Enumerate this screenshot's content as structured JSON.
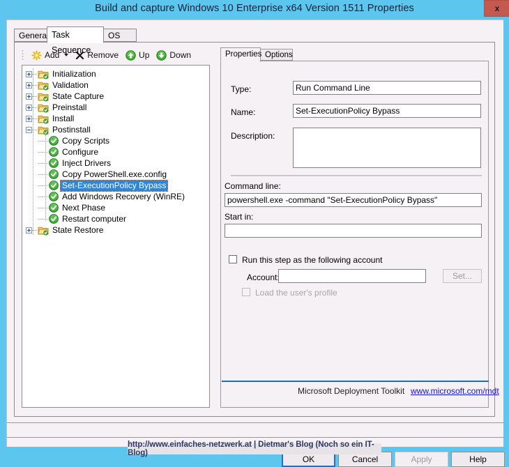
{
  "window": {
    "title": "Build and capture Windows 10 Enterprise x64 Version 1511 Properties",
    "close_label": "x",
    "titlebar_color": "#5cc6ee",
    "close_color": "#c45a4f"
  },
  "tabs": [
    {
      "label": "General",
      "active": false
    },
    {
      "label": "Task Sequence",
      "active": true
    },
    {
      "label": "OS Info",
      "active": false
    }
  ],
  "toolbar": {
    "add_label": "Add",
    "remove_label": "Remove",
    "up_label": "Up",
    "down_label": "Down"
  },
  "tree": {
    "nodes": [
      {
        "label": "Initialization",
        "depth": 0,
        "type": "folder",
        "expander": "plus",
        "selected": false
      },
      {
        "label": "Validation",
        "depth": 0,
        "type": "folder",
        "expander": "plus",
        "selected": false
      },
      {
        "label": "State Capture",
        "depth": 0,
        "type": "folder",
        "expander": "plus",
        "selected": false
      },
      {
        "label": "Preinstall",
        "depth": 0,
        "type": "folder",
        "expander": "plus",
        "selected": false
      },
      {
        "label": "Install",
        "depth": 0,
        "type": "folder",
        "expander": "plus",
        "selected": false
      },
      {
        "label": "Postinstall",
        "depth": 0,
        "type": "folder",
        "expander": "minus",
        "selected": false
      },
      {
        "label": "Copy Scripts",
        "depth": 1,
        "type": "step",
        "expander": "none",
        "selected": false
      },
      {
        "label": "Configure",
        "depth": 1,
        "type": "step",
        "expander": "none",
        "selected": false
      },
      {
        "label": "Inject Drivers",
        "depth": 1,
        "type": "step",
        "expander": "none",
        "selected": false
      },
      {
        "label": "Copy PowerShell.exe.config",
        "depth": 1,
        "type": "step",
        "expander": "none",
        "selected": false
      },
      {
        "label": "Set-ExecutionPolicy Bypass",
        "depth": 1,
        "type": "step",
        "expander": "none",
        "selected": true
      },
      {
        "label": "Add Windows Recovery (WinRE)",
        "depth": 1,
        "type": "step",
        "expander": "none",
        "selected": false
      },
      {
        "label": "Next Phase",
        "depth": 1,
        "type": "step",
        "expander": "none",
        "selected": false
      },
      {
        "label": "Restart computer",
        "depth": 1,
        "type": "step",
        "expander": "none",
        "selected": false
      },
      {
        "label": "State Restore",
        "depth": 0,
        "type": "folder",
        "expander": "plus",
        "selected": false
      }
    ]
  },
  "details": {
    "tabs": [
      {
        "label": "Properties",
        "active": true
      },
      {
        "label": "Options",
        "active": false
      }
    ],
    "type_label": "Type:",
    "type_value": "Run Command Line",
    "name_label": "Name:",
    "name_value": "Set-ExecutionPolicy Bypass",
    "description_label": "Description:",
    "description_value": "",
    "command_line_label": "Command line:",
    "command_line_value": "powershell.exe -command \"Set-ExecutionPolicy Bypass\"",
    "start_in_label": "Start in:",
    "start_in_value": "",
    "run_as_label": "Run this step as the following account",
    "run_as_checked": false,
    "account_label": "Account:",
    "account_value": "",
    "set_button_label": "Set...",
    "load_profile_label": "Load the user's profile",
    "load_profile_checked": false
  },
  "branding": {
    "text": "Microsoft Deployment Toolkit",
    "link": "www.microsoft.com/mdt",
    "accent": "#1b6fb5"
  },
  "dialog_buttons": [
    {
      "label": "OK",
      "default": true,
      "disabled": false
    },
    {
      "label": "Cancel",
      "default": false,
      "disabled": false
    },
    {
      "label": "Apply",
      "default": false,
      "disabled": true
    },
    {
      "label": "Help",
      "default": false,
      "disabled": false
    }
  ],
  "watermark": {
    "text": "http://www.einfaches-netzwerk.at | Dietmar's Blog (Noch so ein IT-Blog)"
  }
}
